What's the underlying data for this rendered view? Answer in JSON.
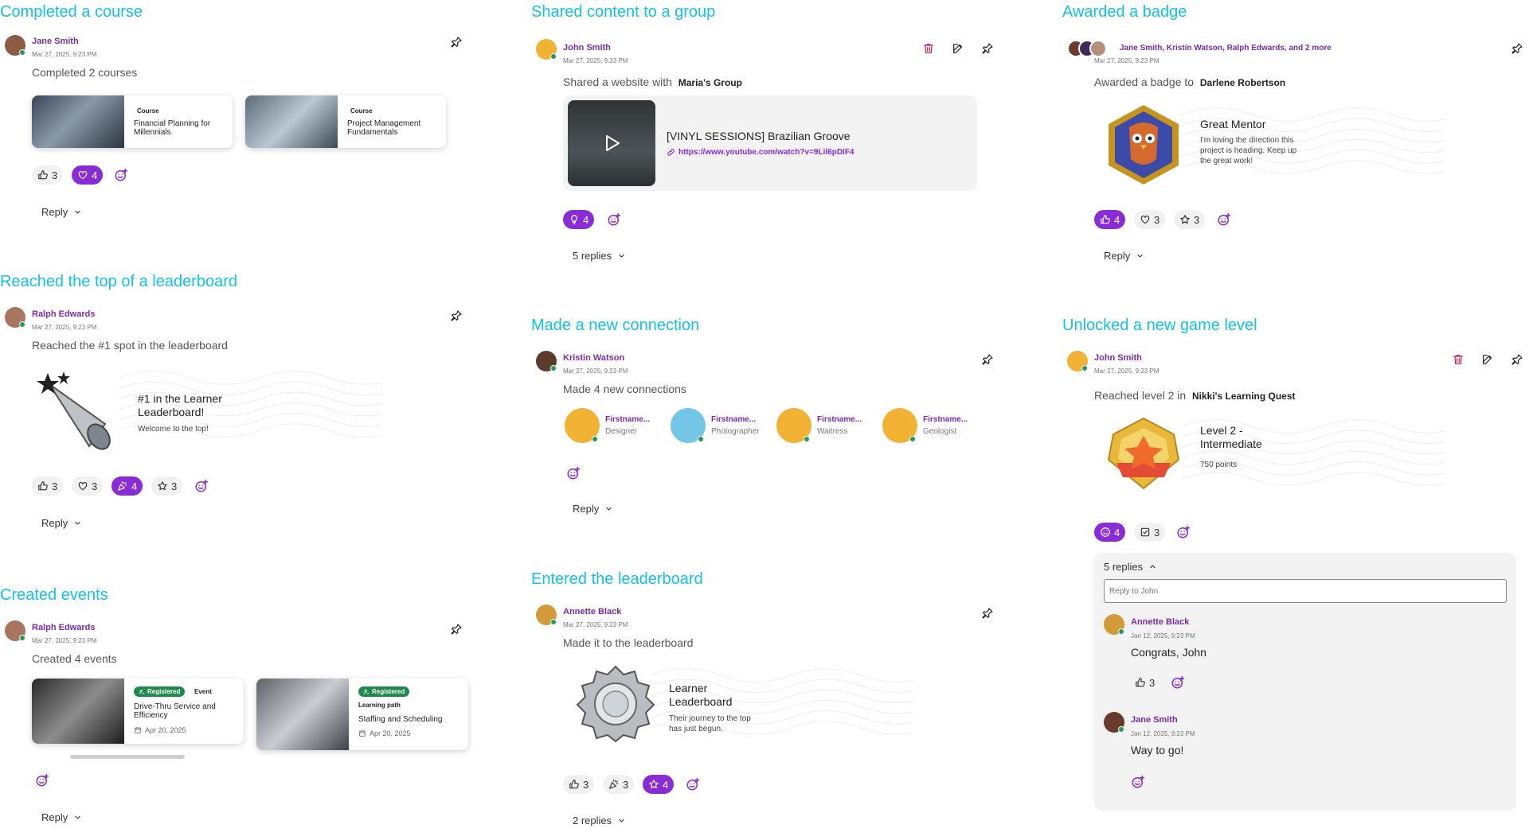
{
  "colors": {
    "accent": "#12c2ea",
    "purple": "#8a2bd8",
    "author": "#7a2aa8",
    "danger": "#c2185b",
    "online": "#1f9d55"
  },
  "completed_course": {
    "title": "Completed a course",
    "author": "Jane Smith",
    "timestamp": "Mar 27, 2025, 9:23 PM",
    "text": "Completed 2 courses",
    "cards": [
      {
        "kicker": "Course",
        "title": "Financial Planning for Millennials"
      },
      {
        "kicker": "Course",
        "title": "Project Management Fundamentals"
      }
    ],
    "reactions": [
      {
        "icon": "thumbs-up-icon",
        "count": "3"
      },
      {
        "icon": "heart-icon",
        "count": "4"
      }
    ],
    "reply_label": "Reply"
  },
  "leaderboard_top": {
    "title": "Reached the top of a leaderboard",
    "author": "Ralph Edwards",
    "timestamp": "Mar 27, 2025, 9:23 PM",
    "text": "Reached the #1 spot in the leaderboard",
    "achievement_title": "#1 in the Learner Leaderboard!",
    "achievement_sub": "Welcome to the top!",
    "reactions": [
      {
        "icon": "thumbs-up-icon",
        "count": "3"
      },
      {
        "icon": "heart-icon",
        "count": "3"
      },
      {
        "icon": "party-icon",
        "count": "4"
      },
      {
        "icon": "star-icon",
        "count": "3"
      }
    ],
    "reply_label": "Reply"
  },
  "created_events": {
    "title": "Created events",
    "author": "Ralph Edwards",
    "timestamp": "Mar 27, 2025, 9:23 PM",
    "text": "Created 4 events",
    "cards": [
      {
        "badge": "Registered",
        "kicker": "Event",
        "title": "Drive-Thru Service and Efficiency",
        "date": "Apr 20, 2025"
      },
      {
        "badge": "Registered",
        "kicker": "Learning path",
        "title": "Staffing and Scheduling",
        "date": "Apr 20, 2025"
      }
    ],
    "reply_label": "Reply"
  },
  "shared_content": {
    "title": "Shared content to a group",
    "author": "John Smith",
    "timestamp": "Mar 27, 2025, 9:23 PM",
    "text_prefix": "Shared a website with",
    "group": "Maria's Group",
    "media_title": "[VINYL SESSIONS] Brazilian Groove",
    "media_url": "https://www.youtube.com/watch?v=9Lil6pDIF4",
    "reactions": [
      {
        "icon": "bulb-icon",
        "count": "4"
      }
    ],
    "replies_label": "5 replies"
  },
  "new_connection": {
    "title": "Made a new connection",
    "author": "Kristin Watson",
    "timestamp": "Mar 27, 2025, 9:23 PM",
    "text": "Made 4 new connections",
    "connections": [
      {
        "name": "Firstname...",
        "role": "Designer"
      },
      {
        "name": "Firstname...",
        "role": "Photographer"
      },
      {
        "name": "Firstname...",
        "role": "Waitress"
      },
      {
        "name": "Firstname...",
        "role": "Geologist"
      }
    ],
    "reply_label": "Reply"
  },
  "entered_leaderboard": {
    "title": "Entered the leaderboard",
    "author": "Annette Black",
    "timestamp": "Mar 27, 2025, 9:23 PM",
    "text": "Made it to the leaderboard",
    "achievement_title": "Learner Leaderboard",
    "achievement_sub": "Their journey to the top has just begun.",
    "reactions": [
      {
        "icon": "thumbs-up-icon",
        "count": "3"
      },
      {
        "icon": "party-icon",
        "count": "3"
      },
      {
        "icon": "star-icon",
        "count": "4"
      }
    ],
    "replies_label": "2 replies"
  },
  "awarded_badge": {
    "title": "Awarded a badge",
    "authors": "Jane Smith, Kristin Watson, Ralph Edwards, and 2 more",
    "timestamp": "Mar 27, 2025, 9:23 PM",
    "text_prefix": "Awarded a badge to",
    "recipient": "Darlene Robertson",
    "achievement_title": "Great Mentor",
    "achievement_sub": "I'm loving the direction this project is heading. Keep up the great work!",
    "reactions": [
      {
        "icon": "thumbs-up-icon",
        "count": "4"
      },
      {
        "icon": "heart-icon",
        "count": "3"
      },
      {
        "icon": "star-icon",
        "count": "3"
      }
    ],
    "reply_label": "Reply"
  },
  "game_level": {
    "title": "Unlocked a new game level",
    "author": "John Smith",
    "timestamp": "Mar 27, 2025, 9:23 PM",
    "text_prefix": "Reached level 2 in",
    "game": "Nikki's Learning Quest",
    "achievement_title": "Level 2 - Intermediate",
    "achievement_sub": "750 points",
    "reactions": [
      {
        "icon": "smile-icon",
        "count": "4"
      },
      {
        "icon": "checkbox-icon",
        "count": "3"
      }
    ],
    "replies_label": "5 replies",
    "reply_placeholder": "Reply to John",
    "replies": [
      {
        "author": "Annette Black",
        "timestamp": "Jan 12, 2025, 9:23 PM",
        "text": "Congrats, John",
        "like_count": "3"
      },
      {
        "author": "Jane Smith",
        "timestamp": "Jan 12, 2025, 9:23 PM",
        "text": "Way to go!"
      }
    ]
  }
}
